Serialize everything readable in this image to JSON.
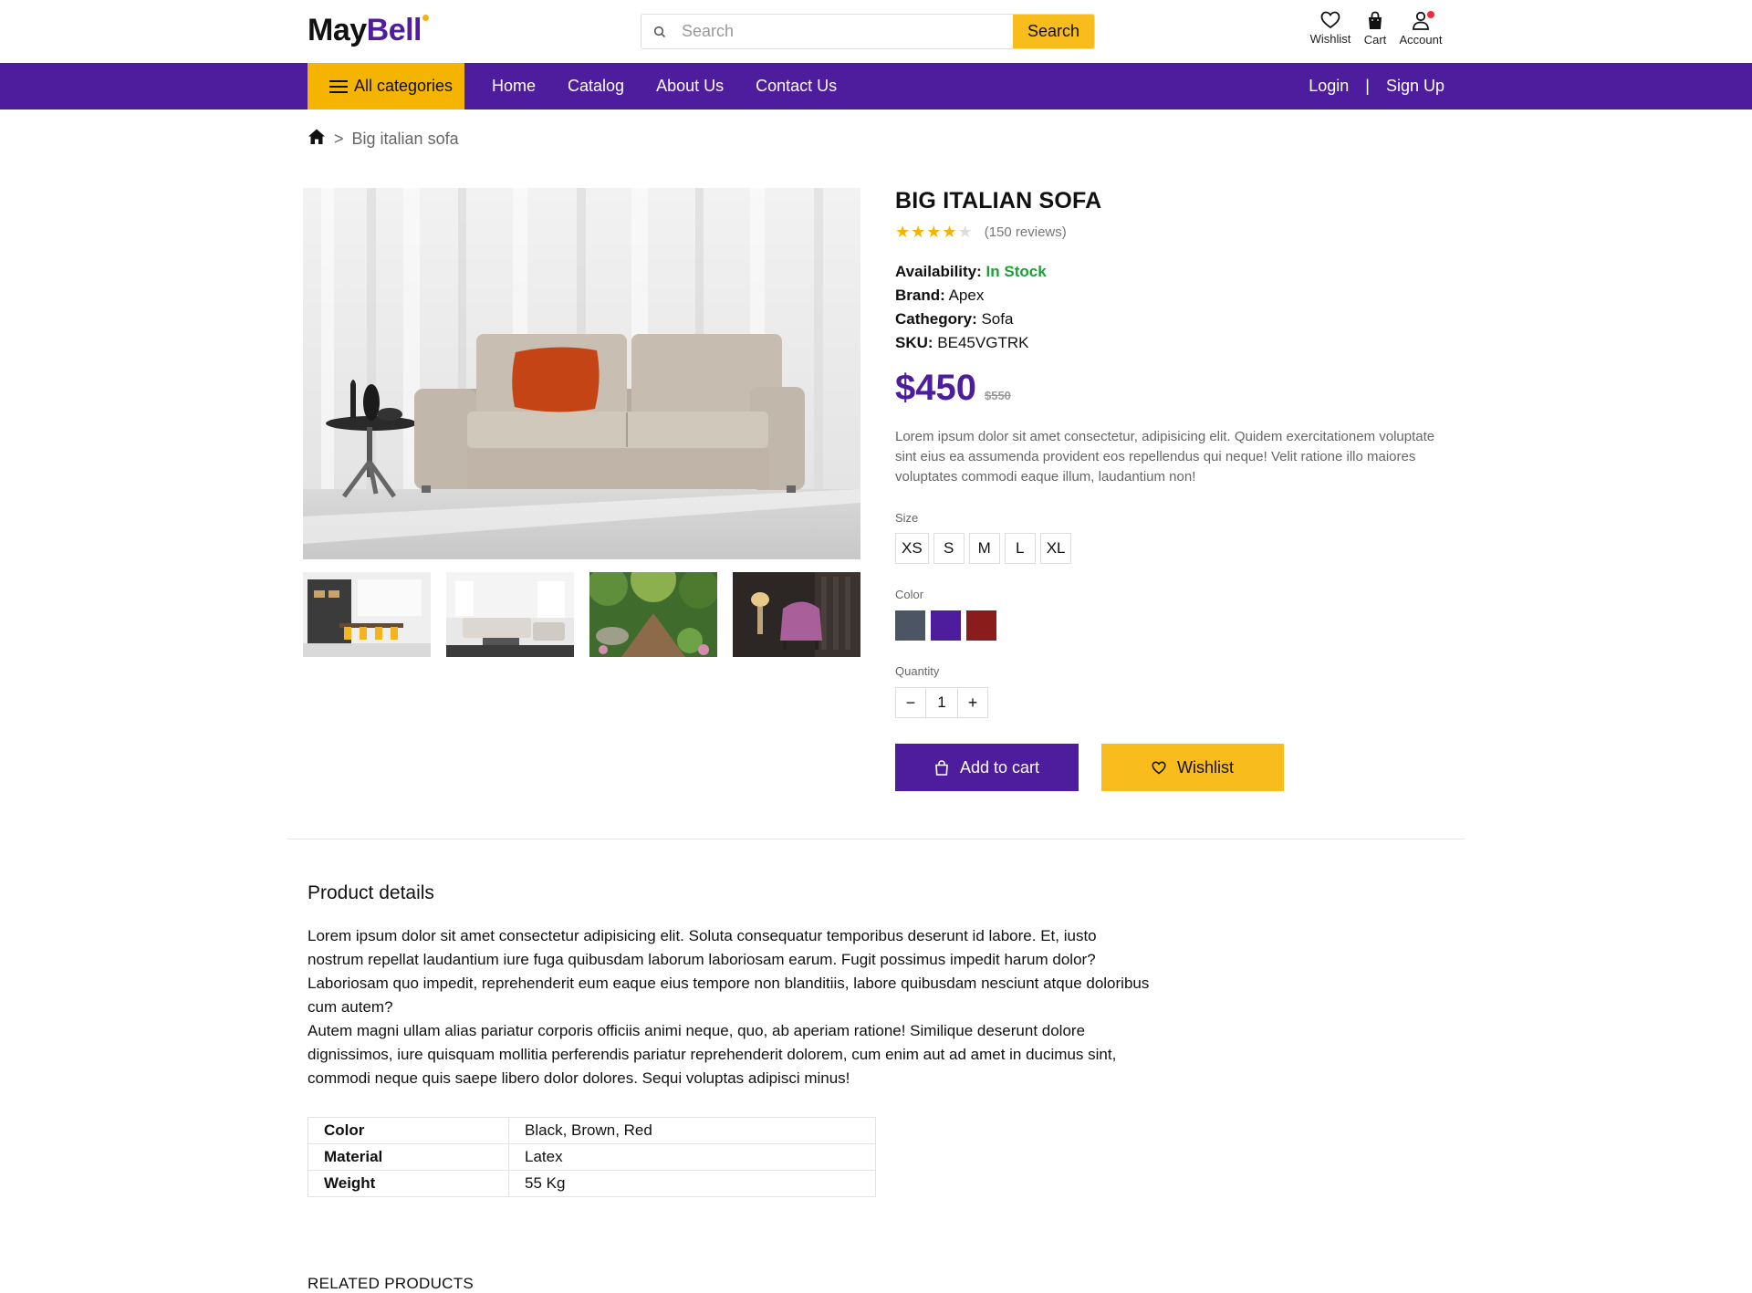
{
  "brand": {
    "name_part1": "May",
    "name_part2": "Bell"
  },
  "search": {
    "placeholder": "Search",
    "button_label": "Search"
  },
  "header_icons": {
    "wishlist": "Wishlist",
    "cart": "Cart",
    "account": "Account"
  },
  "nav": {
    "all_categories": "All categories",
    "links": [
      "Home",
      "Catalog",
      "About Us",
      "Contact Us"
    ],
    "login": "Login",
    "separator": "|",
    "signup": "Sign Up"
  },
  "breadcrumb": {
    "separator": ">",
    "current": "Big italian sofa"
  },
  "product": {
    "title": "BIG ITALIAN SOFA",
    "rating": 4,
    "rating_max": 5,
    "reviews": "(150 reviews)",
    "availability_label": "Availability:",
    "availability_value": "In Stock",
    "brand_label": "Brand:",
    "brand_value": "Apex",
    "category_label": "Cathegory:",
    "category_value": "Sofa",
    "sku_label": "SKU:",
    "sku_value": "BE45VGTRK",
    "price": "$450",
    "old_price": "$550",
    "description": "Lorem ipsum dolor sit amet consectetur, adipisicing elit. Quidem exercitationem voluptate sint eius ea assumenda provident eos repellendus qui neque! Velit ratione illo maiores voluptates commodi eaque illum, laudantium non!",
    "size_label": "Size",
    "sizes": [
      "XS",
      "S",
      "M",
      "L",
      "XL"
    ],
    "color_label": "Color",
    "colors": [
      "#4b5563",
      "#4e1d9d",
      "#8b1c1c"
    ],
    "quantity_label": "Quantity",
    "quantity": "1",
    "qty_minus": "−",
    "qty_plus": "+",
    "add_to_cart": "Add to cart",
    "wishlist": "Wishlist"
  },
  "details": {
    "heading": "Product details",
    "paragraph1": "Lorem ipsum dolor sit amet consectetur adipisicing elit. Soluta consequatur temporibus deserunt id labore. Et, iusto nostrum repellat laudantium iure fuga quibusdam laborum laboriosam earum. Fugit possimus impedit harum dolor? Laboriosam quo impedit, reprehenderit eum eaque eius tempore non blanditiis, labore quibusdam nesciunt atque doloribus cum autem?",
    "paragraph2": "Autem magni ullam alias pariatur corporis officiis animi neque, quo, ab aperiam ratione! Similique deserunt dolore dignissimos, iure quisquam mollitia perferendis pariatur reprehenderit dolorem, cum enim aut ad amet in ducimus sint, commodi neque quis saepe libero dolor dolores. Sequi voluptas adipisci minus!",
    "specs": [
      {
        "key": "Color",
        "value": "Black, Brown, Red"
      },
      {
        "key": "Material",
        "value": "Latex"
      },
      {
        "key": "Weight",
        "value": "55 Kg"
      }
    ]
  },
  "related_heading": "RELATED PRODUCTS",
  "colors": {
    "primary": "#4e1d9d",
    "accent": "#f5b400",
    "instock": "#1e9e3a"
  }
}
